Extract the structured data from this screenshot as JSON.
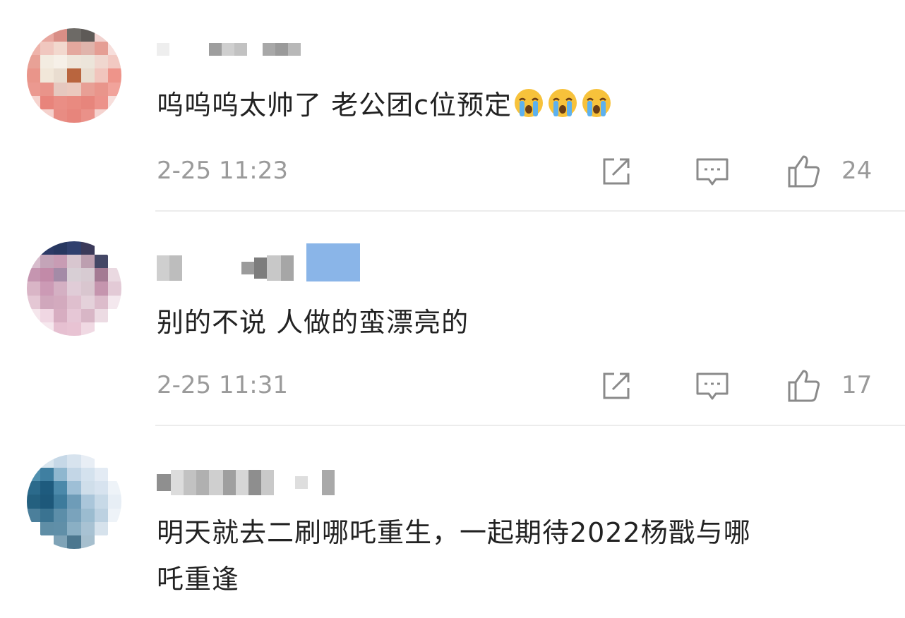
{
  "comments": [
    {
      "text": "呜呜呜太帅了 老公团c位预定",
      "emoji": [
        "loudly-crying-face",
        "loudly-crying-face",
        "loudly-crying-face"
      ],
      "time": "2-25 11:23",
      "likes": "24"
    },
    {
      "text": "别的不说 人做的蛮漂亮的",
      "time": "2-25 11:31",
      "likes": "17"
    },
    {
      "text_line1": "明天就去二刷哪吒重生，一起期待2022杨戬与哪",
      "text_line2": "吒重逢"
    }
  ],
  "icons": {
    "share": "share-icon",
    "reply": "comment-icon",
    "like": "thumbs-up-icon"
  },
  "colors": {
    "text": "#222222",
    "meta": "#9a9a9a",
    "divider": "#ececec"
  }
}
